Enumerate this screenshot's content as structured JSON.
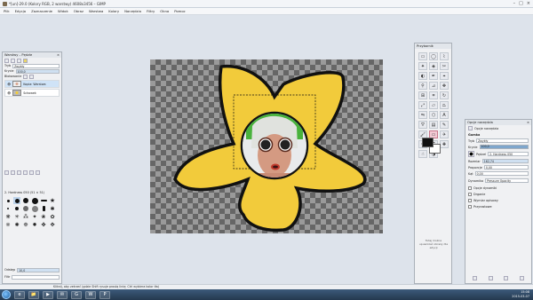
{
  "window": {
    "title": "*[un]-29.0 (Kolory RGB, 2 warstwy) 4608x3456 – GIMP",
    "controls": [
      "–",
      "□",
      "×"
    ]
  },
  "menu": [
    "Plik",
    "Edycja",
    "Zaznaczenie",
    "Widok",
    "Obraz",
    "Warstwa",
    "Kolory",
    "Narzędzia",
    "Filtry",
    "Okna",
    "Pomoc"
  ],
  "layers_panel": {
    "title": "Warstwy – Pędzle",
    "mode_label": "Tryb",
    "mode_value": "Zwykły",
    "opacity_label": "Krycie",
    "opacity_value": "100,0",
    "lock_label": "Blokowanie",
    "layers": [
      {
        "name": "Kopia: Warstwa",
        "thumb": "face"
      },
      {
        "name": "Schowek",
        "thumb": "flower"
      }
    ]
  },
  "brushes_panel": {
    "current": "2. Hardness 050 (51 × 51)",
    "tags_label": "Filtr",
    "spacing_label": "Odstęp",
    "spacing_value": "10,0"
  },
  "toolbox": {
    "title": "Przybornik",
    "hint": "Tutaj można upuszczać obrazy dla edycji"
  },
  "tool_options": {
    "title": "Opcje narzędzia",
    "tab": "Opcje narzędzia",
    "tool_name": "Gumka",
    "mode_label": "Tryb",
    "mode_value": "Zwykły",
    "opacity_label": "Krycie",
    "opacity_value": "100,0",
    "opacity_level": 1.0,
    "brush_label": "Pędzel",
    "brush_value": "2. Hardness 050",
    "size_label": "Rozmiar",
    "size_value": "162,74",
    "aspect_label": "Proporcje",
    "aspect_value": "0,00",
    "angle_label": "Kąt",
    "angle_value": "0,00",
    "dynamics_label": "Dynamika",
    "dynamics_value": "Pressure Opacity",
    "options": [
      "Opcje dynamiki",
      "Drganie",
      "Wymiar opisowy",
      "Przyrostowe"
    ]
  },
  "status": "Kliknij, aby zetrzeć (gdzie Shift rysuje prostą linię; Ctrl wybiera kolor tła)",
  "taskbar": {
    "apps": [
      "e",
      "📁",
      "▶",
      "✉",
      "G",
      "W",
      "P"
    ],
    "time": "15:08",
    "date": "2015-03-07"
  }
}
